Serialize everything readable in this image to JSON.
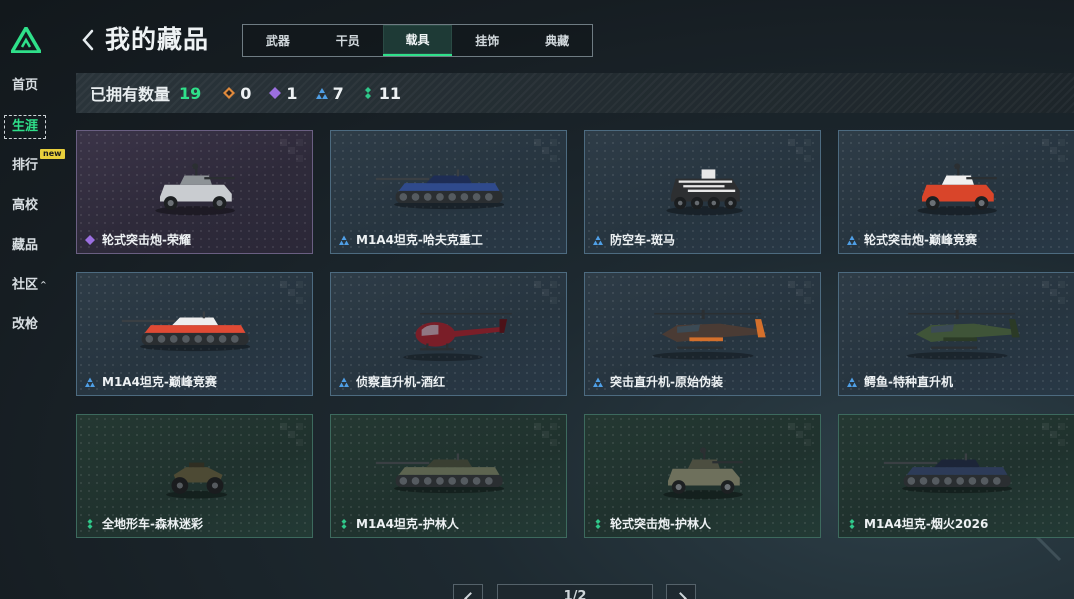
{
  "sidebar": {
    "items": [
      {
        "label": "首页"
      },
      {
        "label": "生涯"
      },
      {
        "label": "排行",
        "badge": "new"
      },
      {
        "label": "高校"
      },
      {
        "label": "藏品"
      },
      {
        "label": "社区",
        "caret": "^"
      },
      {
        "label": "改枪"
      }
    ],
    "active_index": 1
  },
  "header": {
    "title": "我的藏品",
    "tabs": [
      {
        "label": "武器"
      },
      {
        "label": "干员"
      },
      {
        "label": "载具"
      },
      {
        "label": "挂饰"
      },
      {
        "label": "典藏"
      }
    ],
    "active_tab": 2
  },
  "summary": {
    "label": "已拥有数量",
    "total": "19",
    "counts": [
      {
        "rarity": "orange",
        "value": "0"
      },
      {
        "rarity": "purple",
        "value": "1"
      },
      {
        "rarity": "blue",
        "value": "7"
      },
      {
        "rarity": "green",
        "value": "11"
      }
    ]
  },
  "colors": {
    "accent": "#2fe08a",
    "orange": "#e08a3c",
    "purple": "#9b6fe0",
    "blue": "#4f9fe6",
    "green": "#2fc98a"
  },
  "items": [
    {
      "name": "轮式突击炮-荣耀",
      "rarity": "purple",
      "icon": "wheeled-assault-gun"
    },
    {
      "name": "M1A4坦克-哈夫克重工",
      "rarity": "blue",
      "icon": "tank"
    },
    {
      "name": "防空车-斑马",
      "rarity": "blue",
      "icon": "aa-vehicle"
    },
    {
      "name": "轮式突击炮-巅峰竞赛",
      "rarity": "blue",
      "icon": "wheeled-assault-gun"
    },
    {
      "name": "M1A4坦克-巅峰竞赛",
      "rarity": "blue",
      "icon": "tank"
    },
    {
      "name": "侦察直升机-酒红",
      "rarity": "blue",
      "icon": "scout-helicopter"
    },
    {
      "name": "突击直升机-原始伪装",
      "rarity": "blue",
      "icon": "attack-helicopter"
    },
    {
      "name": "鳄鱼-特种直升机",
      "rarity": "blue",
      "icon": "attack-helicopter"
    },
    {
      "name": "全地形车-森林迷彩",
      "rarity": "green",
      "icon": "atv"
    },
    {
      "name": "M1A4坦克-护林人",
      "rarity": "green",
      "icon": "tank"
    },
    {
      "name": "轮式突击炮-护林人",
      "rarity": "green",
      "icon": "wheeled-assault-gun"
    },
    {
      "name": "M1A4坦克-烟火2026",
      "rarity": "green",
      "icon": "tank"
    }
  ],
  "pagination": {
    "text": "1/2"
  }
}
